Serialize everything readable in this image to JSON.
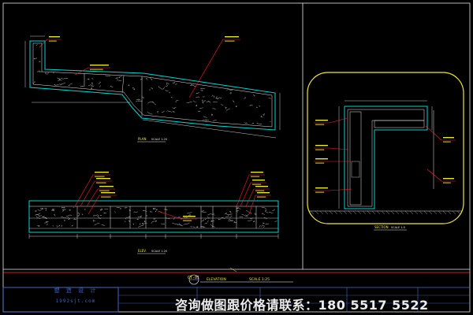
{
  "drawing": {
    "colors": {
      "background": "#000000",
      "frame": "#e8e8e8",
      "stone": "#00d5d5",
      "texture": "#b8b8b8",
      "leader": "#ff2020",
      "dimension": "#ffffff",
      "annotation": "#e8e832",
      "border_accent": "#ff3030",
      "title_block": "#4a6fd6",
      "counter_outline": "#f0e63c"
    },
    "title_block": {
      "sheet_code": "CT-01",
      "drawing_title": "ELEVATION",
      "scale_note": "SCALE 1:25"
    },
    "views": {
      "plan_label": "PLAN",
      "plan_scale": "SCALE 1:20",
      "elevation_label": "ELEV.",
      "elevation_scale": "SCALE 1:20",
      "section_label": "SECTION",
      "section_scale": "SCALE 1:5"
    },
    "logo": {
      "line1": "塑 造 设 计",
      "line2": "1992sjt.com"
    },
    "watermark": "咨询做图跟价格请联系：180 5517 5522"
  }
}
